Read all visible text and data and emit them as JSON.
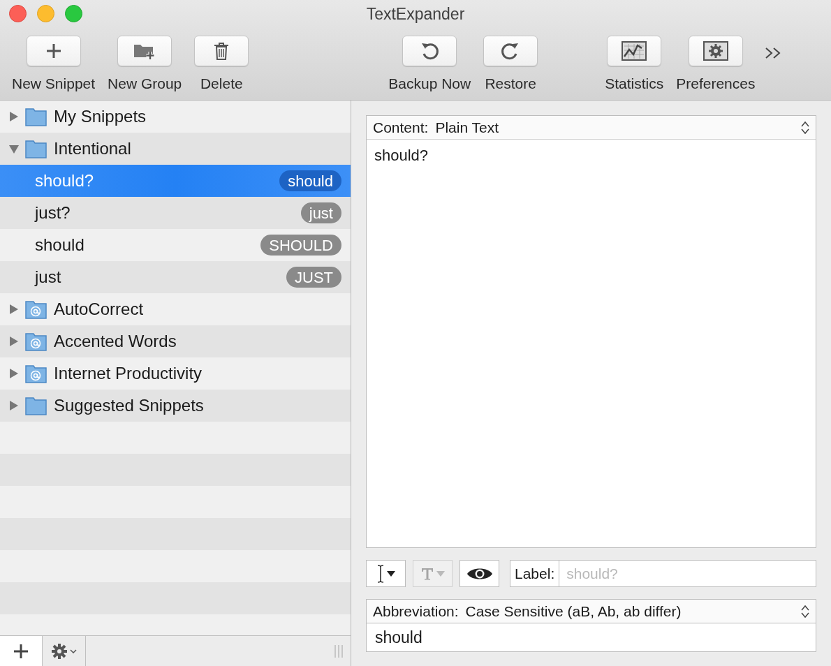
{
  "window": {
    "title": "TextExpander"
  },
  "toolbar": {
    "groups": [
      [
        {
          "label": "New Snippet"
        },
        {
          "label": "New Group"
        },
        {
          "label": "Delete"
        }
      ],
      [
        {
          "label": "Backup Now"
        },
        {
          "label": "Restore"
        }
      ],
      [
        {
          "label": "Statistics"
        },
        {
          "label": "Preferences"
        }
      ]
    ]
  },
  "sidebar": {
    "items": [
      {
        "kind": "folder",
        "label": "My Snippets",
        "expanded": false,
        "selected": false
      },
      {
        "kind": "folder",
        "label": "Intentional",
        "expanded": true,
        "selected": false,
        "children": [
          {
            "kind": "snippet",
            "label": "should?",
            "abbreviation": "should",
            "selected": true
          },
          {
            "kind": "snippet",
            "label": "just?",
            "abbreviation": "just",
            "selected": false
          },
          {
            "kind": "snippet",
            "label": "should",
            "abbreviation": "SHOULD",
            "selected": false
          },
          {
            "kind": "snippet",
            "label": "just",
            "abbreviation": "JUST",
            "selected": false
          }
        ]
      },
      {
        "kind": "at_folder",
        "label": "AutoCorrect",
        "expanded": false,
        "selected": false
      },
      {
        "kind": "at_folder",
        "label": "Accented Words",
        "expanded": false,
        "selected": false
      },
      {
        "kind": "at_folder",
        "label": "Internet Productivity",
        "expanded": false,
        "selected": false
      },
      {
        "kind": "folder",
        "label": "Suggested Snippets",
        "expanded": false,
        "selected": false
      }
    ]
  },
  "content": {
    "label": "Content:",
    "format": "Plain Text",
    "text": "should?"
  },
  "tool_buttons": [
    {
      "disabled": false
    },
    {
      "disabled": true
    },
    {
      "disabled": false
    }
  ],
  "label_field": {
    "label": "Label:",
    "placeholder": "should?"
  },
  "abbreviation": {
    "label": "Abbreviation:",
    "mode": "Case Sensitive (aB, Ab, ab differ)",
    "value": "should"
  }
}
